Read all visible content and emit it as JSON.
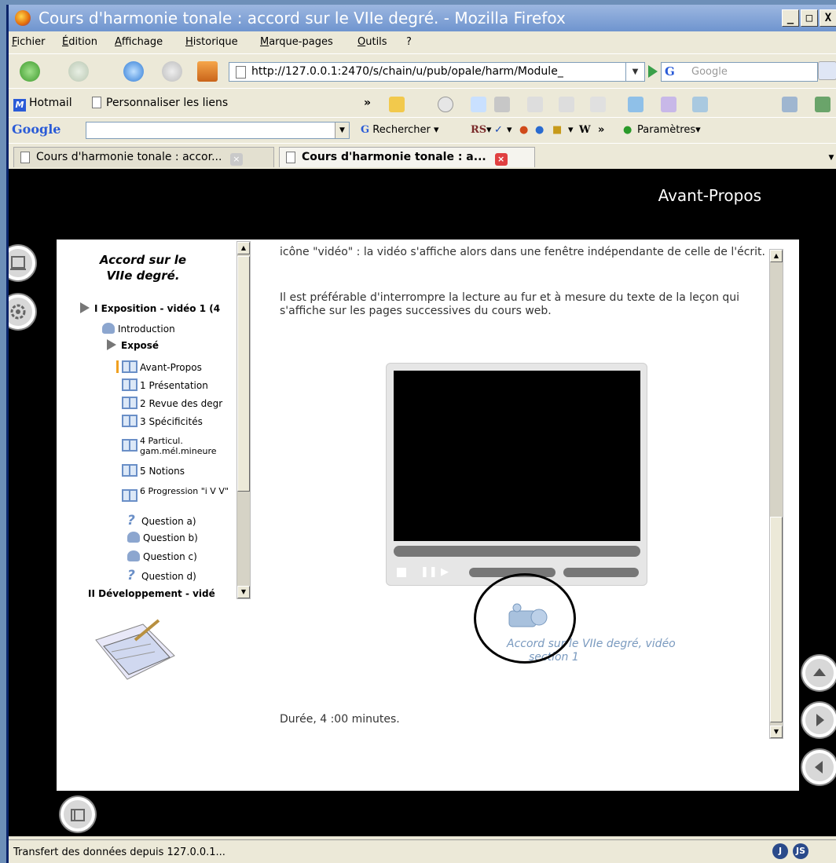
{
  "window": {
    "title": "Cours d'harmonie tonale : accord sur le VIIe degré. - Mozilla Firefox",
    "buttons": [
      "_",
      "□",
      "X"
    ]
  },
  "menu": [
    "Fichier",
    "Édition",
    "Affichage",
    "Historique",
    "Marque-pages",
    "Outils",
    "?"
  ],
  "navbar": {
    "url": "http://127.0.0.1:2470/s/chain/u/pub/opale/harm/Module_",
    "search_placeholder": "Google",
    "search_engine_icon": "G"
  },
  "bookmarks": {
    "hotmail": "Hotmail",
    "personnaliser": "Personnaliser les liens",
    "chevron": "»"
  },
  "googlebar": {
    "logo": "Google",
    "rechercher": "Rechercher",
    "rs": "RS",
    "w": "W",
    "more": "»",
    "parametres": "Paramètres"
  },
  "tabs": [
    {
      "label": "Cours d'harmonie tonale : accor..."
    },
    {
      "label": "Cours d'harmonie tonale : a..."
    }
  ],
  "page": {
    "header_title": "Avant-Propos",
    "sidebar": {
      "title": "Accord sur le VIIe degré.",
      "section1": "I Exposition - vidéo 1 (4",
      "introduction": "Introduction",
      "expose": "Exposé",
      "items": [
        "Avant-Propos",
        "1 Présentation",
        "2 Revue des degr",
        "3 Spécificités",
        "4 Particul. gam.mél.mineure",
        "5 Notions",
        "6 Progression \"i V V\""
      ],
      "questions": [
        "Question a)",
        "Question b)",
        "Question c)",
        "Question d)"
      ],
      "section2": "II Développement - vidé"
    },
    "text_top": "icône \"vidéo\" : la vidéo s'affiche alors dans une fenêtre indépendante de celle de l'écrit.",
    "text_para": "Il est préférable d'interrompre la lecture au fur et à mesure du texte de la leçon qui s'affiche sur les pages successives du cours web.",
    "video_link": "Accord sur le VIIe degré, vidéo",
    "video_link_line2": "section 1",
    "duration": "Durée, 4 :00 minutes."
  },
  "status": {
    "text": "Transfert des données depuis 127.0.0.1...",
    "icons": [
      "J",
      "JS"
    ]
  }
}
